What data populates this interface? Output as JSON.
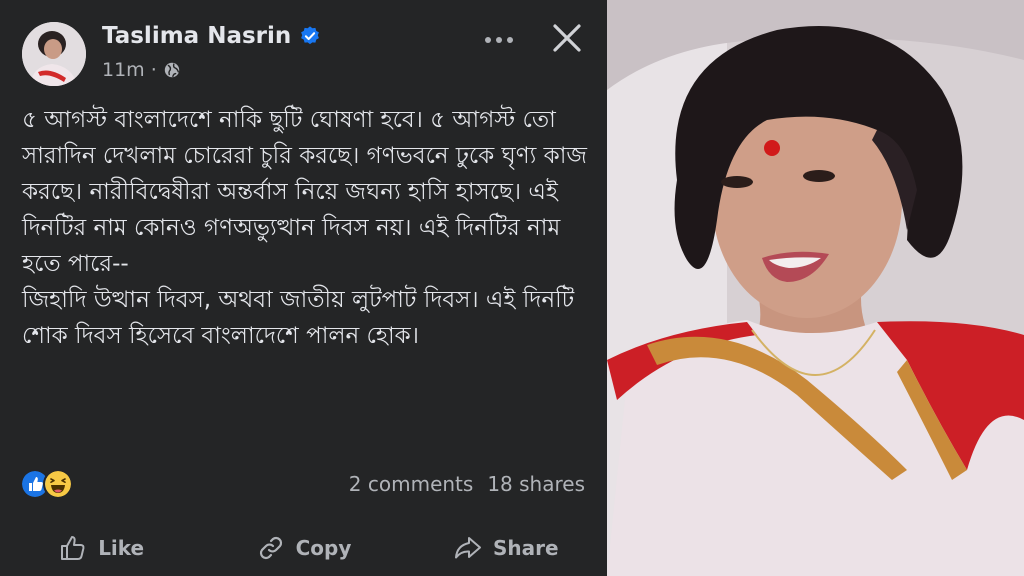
{
  "post": {
    "author": "Taslima Nasrin",
    "time": "11m",
    "separator": "·",
    "body": "৫ আগস্ট বাংলাদেশে নাকি ছুটি ঘোষণা হবে। ৫ আগস্ট তো সারাদিন দেখলাম চোরেরা চুরি করছে। গণভবনে ঢুকে ঘৃণ্য কাজ করছে।  নারীবিদ্বেষীরা অন্তর্বাস নিয়ে জঘন্য হাসি হাসছে। এই দিনটির নাম কোনও গণঅভ্যুত্থান দিবস নয়। এই দিনটির নাম হতে পারে--\nজিহাদি উত্থান দিবস, অথবা জাতীয় লুটপাট দিবস। এই দিনটি শোক দিবস হিসেবে বাংলাদেশে পালন হোক।",
    "comments": "2 comments",
    "shares": "18 shares"
  },
  "actions": {
    "like": "Like",
    "copy": "Copy",
    "share": "Share"
  },
  "icons": {
    "verified": "verified-badge-icon",
    "globe": "globe-icon",
    "more": "more-options-icon",
    "close": "close-icon",
    "like_reaction": "like-reaction-icon",
    "haha_reaction": "haha-reaction-icon"
  },
  "colors": {
    "background": "#242526",
    "text": "#e4e6eb",
    "secondary": "#b0b3b8",
    "accent": "#1877f2"
  }
}
